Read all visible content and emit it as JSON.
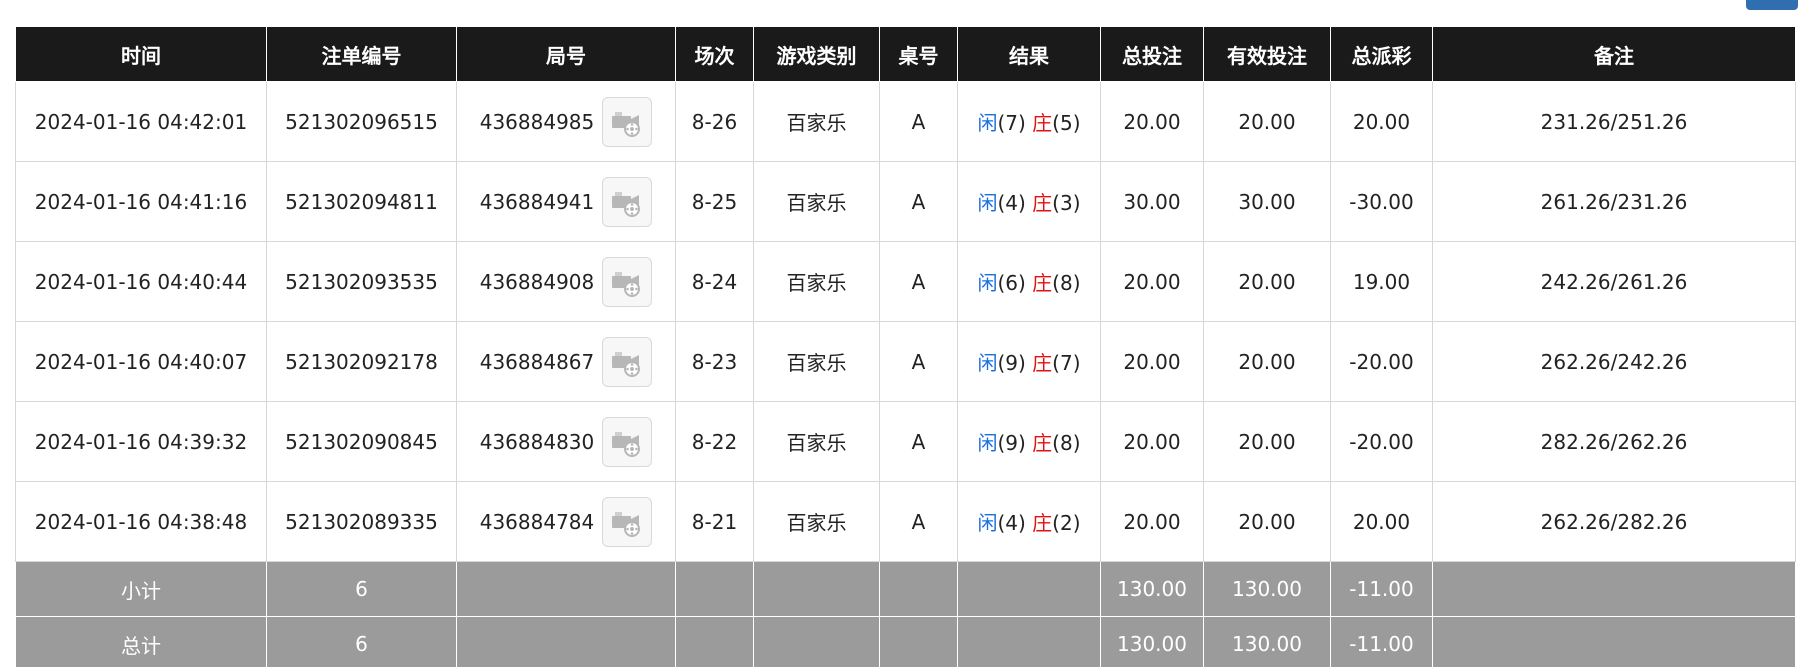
{
  "colors": {
    "header_bg": "#1a1a1a",
    "summary_bg": "#9b9b9b",
    "player": "#1a6fe0",
    "banker": "#e01212",
    "bet_blue": "#1a6fe0",
    "negative_red": "#e01212"
  },
  "table": {
    "headers": [
      "时间",
      "注单编号",
      "局号",
      "场次",
      "游戏类别",
      "桌号",
      "结果",
      "总投注",
      "有效投注",
      "总派彩",
      "备注"
    ],
    "player_label": "闲",
    "banker_label": "庄",
    "replay_icon": "video-replay-icon",
    "rows": [
      {
        "time": "2024-01-16 04:42:01",
        "bet_id": "521302096515",
        "round_id": "436884985",
        "shoe": "8-26",
        "game": "百家乐",
        "table_no": "A",
        "player_points": "(7)",
        "banker_points": "(5)",
        "total_bet": "20.00",
        "valid_bet": "20.00",
        "payout": "20.00",
        "payout_negative": false,
        "note": "231.26/251.26"
      },
      {
        "time": "2024-01-16 04:41:16",
        "bet_id": "521302094811",
        "round_id": "436884941",
        "shoe": "8-25",
        "game": "百家乐",
        "table_no": "A",
        "player_points": "(4)",
        "banker_points": "(3)",
        "total_bet": "30.00",
        "valid_bet": "30.00",
        "payout": "-30.00",
        "payout_negative": true,
        "note": "261.26/231.26"
      },
      {
        "time": "2024-01-16 04:40:44",
        "bet_id": "521302093535",
        "round_id": "436884908",
        "shoe": "8-24",
        "game": "百家乐",
        "table_no": "A",
        "player_points": "(6)",
        "banker_points": "(8)",
        "total_bet": "20.00",
        "valid_bet": "20.00",
        "payout": "19.00",
        "payout_negative": false,
        "note": "242.26/261.26"
      },
      {
        "time": "2024-01-16 04:40:07",
        "bet_id": "521302092178",
        "round_id": "436884867",
        "shoe": "8-23",
        "game": "百家乐",
        "table_no": "A",
        "player_points": "(9)",
        "banker_points": "(7)",
        "total_bet": "20.00",
        "valid_bet": "20.00",
        "payout": "-20.00",
        "payout_negative": true,
        "note": "262.26/242.26"
      },
      {
        "time": "2024-01-16 04:39:32",
        "bet_id": "521302090845",
        "round_id": "436884830",
        "shoe": "8-22",
        "game": "百家乐",
        "table_no": "A",
        "player_points": "(9)",
        "banker_points": "(8)",
        "total_bet": "20.00",
        "valid_bet": "20.00",
        "payout": "-20.00",
        "payout_negative": true,
        "note": "282.26/262.26"
      },
      {
        "time": "2024-01-16 04:38:48",
        "bet_id": "521302089335",
        "round_id": "436884784",
        "shoe": "8-21",
        "game": "百家乐",
        "table_no": "A",
        "player_points": "(4)",
        "banker_points": "(2)",
        "total_bet": "20.00",
        "valid_bet": "20.00",
        "payout": "20.00",
        "payout_negative": false,
        "note": "262.26/282.26"
      }
    ],
    "summary": [
      {
        "label": "小计",
        "count": "6",
        "total_bet": "130.00",
        "valid_bet": "130.00",
        "payout": "-11.00"
      },
      {
        "label": "总计",
        "count": "6",
        "total_bet": "130.00",
        "valid_bet": "130.00",
        "payout": "-11.00"
      }
    ]
  }
}
